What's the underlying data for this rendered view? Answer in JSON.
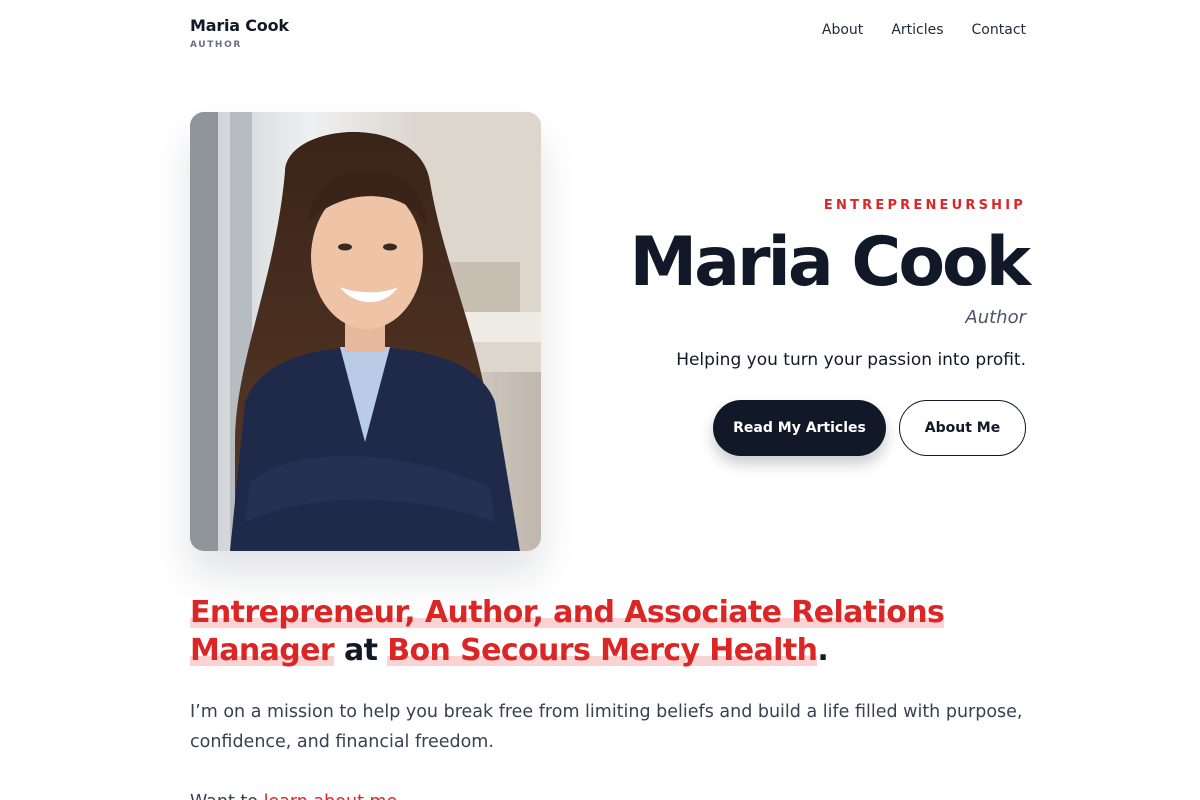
{
  "header": {
    "brand_name": "Maria Cook",
    "brand_role": "AUTHOR",
    "nav": [
      "About",
      "Articles",
      "Contact"
    ]
  },
  "hero": {
    "kicker": "ENTREPRENEURSHIP",
    "name": "Maria Cook",
    "role": "Author",
    "tagline": "Helping you turn your passion into profit.",
    "primary_button": "Read My Articles",
    "secondary_button": "About Me"
  },
  "headline": {
    "part1": "Entrepreneur, Author, and Associate Relations Manager",
    "connector": " at ",
    "part2": "Bon Secours Mercy Health",
    "end": "."
  },
  "intro": "I’m on a mission to help you break free from limiting beliefs and build a life filled with purpose, confidence, and financial freedom.",
  "more": {
    "prefix": "Want to ",
    "link": "learn about me"
  },
  "colors": {
    "accent": "#dc2626",
    "highlight": "#fcd3d3",
    "dark": "#111827"
  }
}
